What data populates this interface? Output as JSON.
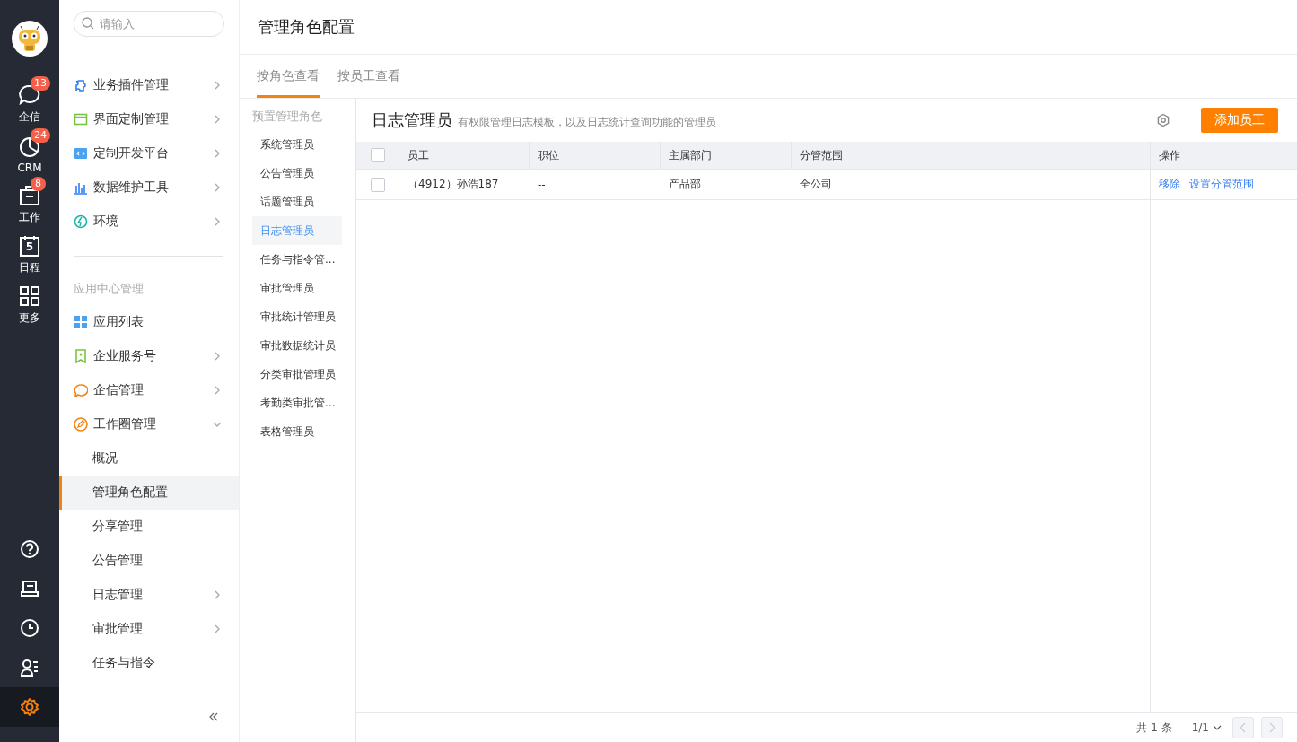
{
  "rail": {
    "top": [
      {
        "label": "企信",
        "badge": "13"
      },
      {
        "label": "CRM",
        "badge": "24"
      },
      {
        "label": "工作",
        "badge": "8"
      },
      {
        "label": "日程",
        "day": "5"
      },
      {
        "label": "更多"
      }
    ],
    "bottom": [
      {
        "selected": false
      },
      {
        "selected": false
      },
      {
        "selected": false
      },
      {
        "selected": false
      },
      {
        "selected": true
      }
    ]
  },
  "nav": {
    "search": {
      "placeholder": "请输入"
    },
    "items": [
      {
        "label": "业务插件管理",
        "has_children": true
      },
      {
        "label": "界面定制管理",
        "has_children": true
      },
      {
        "label": "定制开发平台",
        "has_children": true
      },
      {
        "label": "数据维护工具",
        "has_children": true
      },
      {
        "label": "环境",
        "has_children": true
      }
    ],
    "section": "应用中心管理",
    "section_items": [
      {
        "label": "应用列表",
        "has_children": false
      },
      {
        "label": "企业服务号",
        "has_children": true
      },
      {
        "label": "企信管理",
        "has_children": true
      },
      {
        "label": "工作圈管理",
        "has_children": true,
        "expanded": true,
        "children": [
          {
            "label": "概况",
            "selected": false,
            "has_children": false
          },
          {
            "label": "管理角色配置",
            "selected": true,
            "has_children": false
          },
          {
            "label": "分享管理",
            "selected": false,
            "has_children": false
          },
          {
            "label": "公告管理",
            "selected": false,
            "has_children": false
          },
          {
            "label": "日志管理",
            "selected": false,
            "has_children": true
          },
          {
            "label": "审批管理",
            "selected": false,
            "has_children": true
          },
          {
            "label": "任务与指令",
            "selected": false,
            "has_children": false
          }
        ]
      }
    ]
  },
  "page": {
    "title": "管理角色配置",
    "tabs": [
      {
        "label": "按角色查看",
        "selected": true
      },
      {
        "label": "按员工查看",
        "selected": false
      }
    ],
    "roles": {
      "header": "预置管理角色",
      "items": [
        {
          "label": "系统管理员",
          "selected": false
        },
        {
          "label": "公告管理员",
          "selected": false
        },
        {
          "label": "话题管理员",
          "selected": false
        },
        {
          "label": "日志管理员",
          "selected": true
        },
        {
          "label": "任务与指令管...",
          "selected": false
        },
        {
          "label": "审批管理员",
          "selected": false
        },
        {
          "label": "审批统计管理员",
          "selected": false
        },
        {
          "label": "审批数据统计员",
          "selected": false
        },
        {
          "label": "分类审批管理员",
          "selected": false
        },
        {
          "label": "考勤类审批管...",
          "selected": false
        },
        {
          "label": "表格管理员",
          "selected": false
        }
      ]
    },
    "panel": {
      "title": "日志管理员",
      "description": "有权限管理日志模板，以及日志统计查询功能的管理员",
      "add_button": "添加员工"
    },
    "table": {
      "header_checked": false,
      "columns": [
        "员工",
        "职位",
        "主属部门",
        "分管范围",
        "操作"
      ],
      "rows": [
        {
          "checked": false,
          "cells": [
            "（4912）孙浩187",
            "--",
            "产品部",
            "全公司"
          ],
          "actions": [
            "移除",
            "设置分管范围"
          ]
        }
      ]
    },
    "footer": {
      "total": "共 1 条",
      "page": "1/1"
    }
  }
}
